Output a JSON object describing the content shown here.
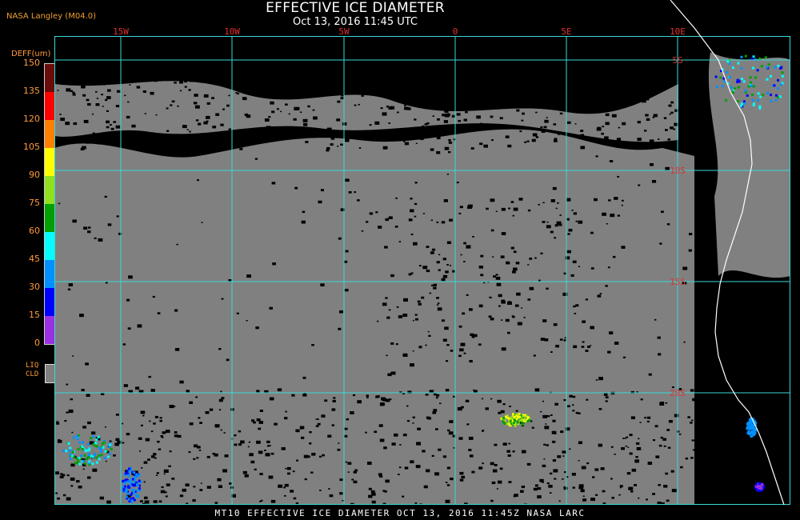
{
  "header": {
    "title": "EFFECTIVE ICE DIAMETER",
    "subtitle": "Oct 13, 2016 11:45 UTC",
    "credit": "NASA Langley (M04.0)"
  },
  "legend": {
    "unit_label": "DEFF(um)",
    "ticks": [
      "150",
      "135",
      "120",
      "105",
      "90",
      "75",
      "60",
      "45",
      "30",
      "15",
      "0"
    ],
    "colors": [
      "#6b0b0b",
      "#ff0000",
      "#ff8000",
      "#ffff00",
      "#90e020",
      "#00a000",
      "#00ffff",
      "#0090ff",
      "#0000ff",
      "#9a30e0"
    ],
    "liquid_cloud_label": "LIQ\nCLD",
    "liquid_cloud_color": "#808080"
  },
  "map": {
    "background_color": "#000000",
    "cloud_color": "#808080",
    "grid_color": "#3ad8d8",
    "coastline_color": "#ffffff",
    "longitude_labels": [
      "15W",
      "10W",
      "5W",
      "0",
      "5E",
      "10E"
    ],
    "latitude_labels": [
      "5S",
      "10S",
      "15S",
      "20S"
    ]
  },
  "footer": {
    "text": "MT10  EFFECTIVE ICE DIAMETER  OCT 13, 2016 11:45Z  NASA LARC"
  }
}
